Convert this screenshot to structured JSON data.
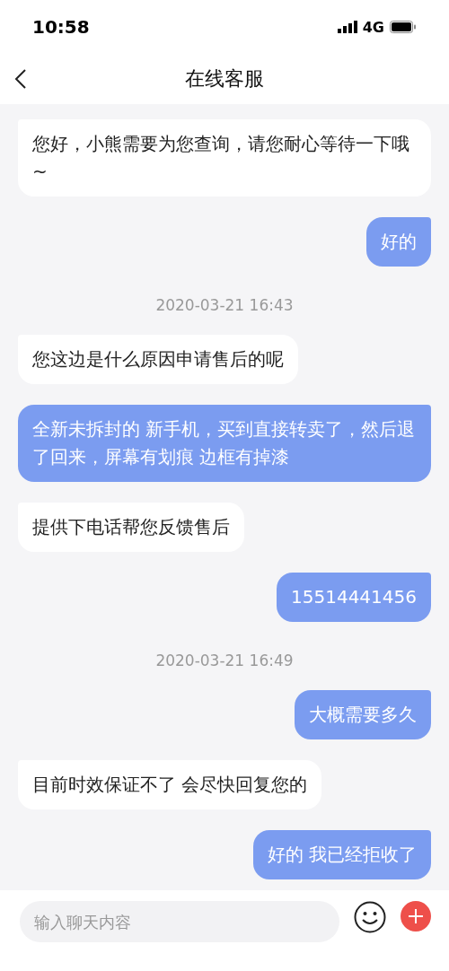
{
  "status_bar": {
    "time": "10:58",
    "network": "4G"
  },
  "header": {
    "title": "在线客服"
  },
  "messages": [
    {
      "kind": "received",
      "text": "您好，小熊需要为您查询，请您耐心等待一下哦~"
    },
    {
      "kind": "sent",
      "text": "好的"
    },
    {
      "kind": "time",
      "text": "2020-03-21 16:43"
    },
    {
      "kind": "received",
      "text": "您这边是什么原因申请售后的呢"
    },
    {
      "kind": "sent",
      "text": "全新未拆封的 新手机，买到直接转卖了，然后退了回来，屏幕有划痕 边框有掉漆"
    },
    {
      "kind": "received",
      "text": "提供下电话帮您反馈售后"
    },
    {
      "kind": "sent",
      "text": "15514441456"
    },
    {
      "kind": "time",
      "text": "2020-03-21 16:49"
    },
    {
      "kind": "sent",
      "text": "大概需要多久"
    },
    {
      "kind": "received",
      "text": "目前时效保证不了 会尽快回复您的"
    },
    {
      "kind": "sent",
      "text": "好的 我已经拒收了"
    }
  ],
  "composer": {
    "placeholder": "输入聊天内容"
  }
}
